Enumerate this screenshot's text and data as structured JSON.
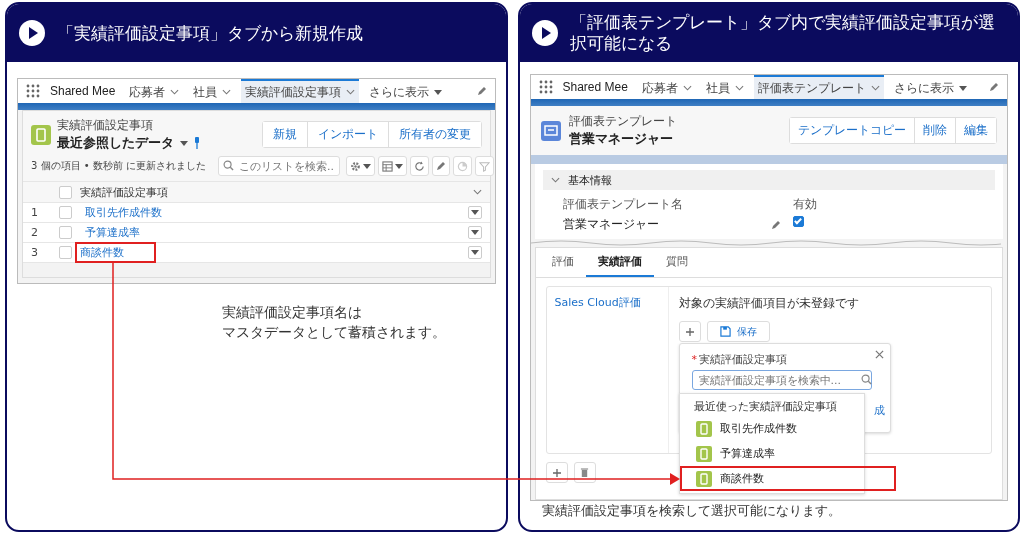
{
  "left_panel": {
    "title": "「実績評価設定事項」タブから新規作成",
    "nav": {
      "app_name": "Shared Mee",
      "tabs": [
        {
          "label": "応募者",
          "selected": false
        },
        {
          "label": "社員",
          "selected": false
        },
        {
          "label": "実績評価設定事項",
          "selected": true
        }
      ],
      "more": "さらに表示"
    },
    "object_label": "実績評価設定事項",
    "list_name": "最近参照したデータ",
    "buttons": [
      "新規",
      "インポート",
      "所有者の変更"
    ],
    "status": "3 個の項目 • 数秒前 に更新されました",
    "search_placeholder": "このリストを検索...",
    "column": "実績評価設定事項",
    "select_all_checked": false,
    "rows": [
      {
        "number": "1",
        "name": "取引先作成件数",
        "checked": false,
        "highlighted": false
      },
      {
        "number": "2",
        "name": "予算達成率",
        "checked": false,
        "highlighted": false
      },
      {
        "number": "3",
        "name": "商談件数",
        "checked": false,
        "highlighted": true
      }
    ],
    "note": [
      "実績評価設定事項名は",
      "マスタデータとして蓄積されます。"
    ]
  },
  "right_panel": {
    "title": "「評価表テンプレート」タブ内で実績評価設定事項が選択可能になる",
    "nav": {
      "app_name": "Shared Mee",
      "tabs": [
        {
          "label": "応募者",
          "selected": false
        },
        {
          "label": "社員",
          "selected": false
        },
        {
          "label": "評価表テンプレート",
          "selected": true
        }
      ],
      "more": "さらに表示"
    },
    "object_label": "評価表テンプレート",
    "record_name": "営業マネージャー",
    "buttons": [
      "テンプレートコピー",
      "削除",
      "編集"
    ],
    "section": {
      "title": "基本情報",
      "expanded": true
    },
    "fields": [
      {
        "kind": "text",
        "label": "評価表テンプレート名",
        "value": "営業マネージャー"
      },
      {
        "kind": "checkbox",
        "label": "有効",
        "checked": true
      }
    ],
    "tabs": [
      {
        "label": "評価",
        "selected": false
      },
      {
        "label": "実績評価",
        "selected": true
      },
      {
        "label": "質問",
        "selected": false
      }
    ],
    "sidebar_item": "Sales Cloud評価",
    "message": "対象の実績評価項目が未登録です",
    "save_button": "保存",
    "popover": {
      "label": "実績評価設定事項",
      "required_mark": "*",
      "placeholder": "実績評価設定事項を検索中...",
      "link_fragment": "成"
    },
    "dropdown": {
      "header": "最近使った実績評価設定事項",
      "items": [
        {
          "label": "取引先作成件数",
          "highlighted": false
        },
        {
          "label": "予算達成率",
          "highlighted": false
        },
        {
          "label": "商談件数",
          "highlighted": true
        }
      ]
    },
    "caption": "実績評価設定事項を検索して選択可能になります。"
  }
}
